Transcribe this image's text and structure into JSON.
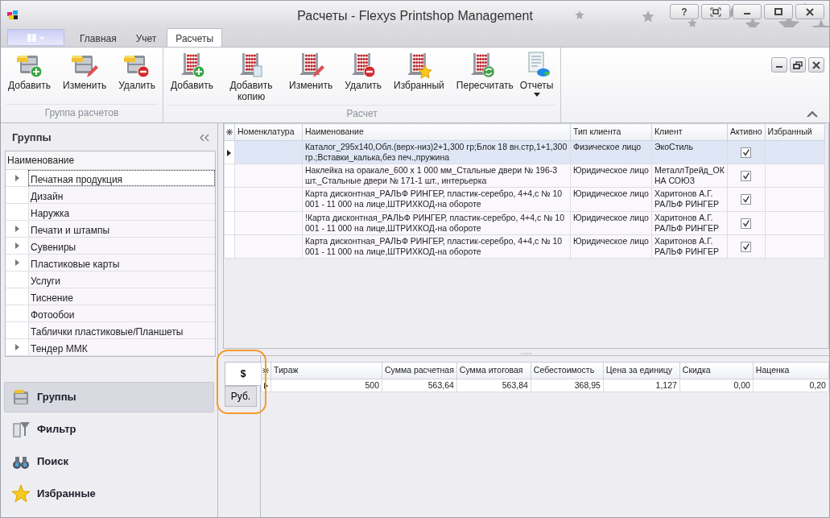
{
  "window": {
    "title": "Расчеты - Flexys Printshop Management",
    "controls": [
      {
        "kind": "help",
        "label": "?"
      },
      {
        "kind": "fullscreen"
      },
      {
        "kind": "minimize"
      },
      {
        "kind": "maximize"
      },
      {
        "kind": "close"
      }
    ],
    "mdi_controls": [
      {
        "kind": "minimize"
      },
      {
        "kind": "restore"
      },
      {
        "kind": "close"
      }
    ]
  },
  "ribbon": {
    "tabs": [
      {
        "label": "Главная",
        "selected": false
      },
      {
        "label": "Учет",
        "selected": false
      },
      {
        "label": "Расчеты",
        "selected": true
      }
    ],
    "groups": [
      {
        "title": "Группа расчетов",
        "kind": "cabinet",
        "buttons": [
          {
            "label": "Добавить",
            "kind": "add"
          },
          {
            "label": "Изменить",
            "kind": "edit"
          },
          {
            "label": "Удалить",
            "kind": "delete"
          }
        ]
      },
      {
        "title": "Расчет",
        "kind": "abacus",
        "buttons": [
          {
            "label": "Добавить",
            "kind": "add"
          },
          {
            "label": "Добавить копию",
            "kind": "copy"
          },
          {
            "label": "Изменить",
            "kind": "edit"
          },
          {
            "label": "Удалить",
            "kind": "delete"
          },
          {
            "label": "Избранный",
            "kind": "favorite"
          },
          {
            "label": "Пересчитать",
            "kind": "recalc"
          },
          {
            "label": "Отчеты",
            "kind": "report",
            "dropdown": true
          }
        ]
      }
    ]
  },
  "left_panel": {
    "title": "Группы",
    "tree": {
      "column": "Наименование",
      "items": [
        {
          "label": "Печатная продукция",
          "expandable": true,
          "selected": true
        },
        {
          "label": "Дизайн",
          "expandable": false,
          "selected": false
        },
        {
          "label": "Наружка",
          "expandable": false,
          "selected": false
        },
        {
          "label": "Печати и штампы",
          "expandable": true,
          "selected": false
        },
        {
          "label": "Сувениры",
          "expandable": true,
          "selected": false
        },
        {
          "label": "Пластиковые карты",
          "expandable": true,
          "selected": false
        },
        {
          "label": "Услуги",
          "expandable": false,
          "selected": false
        },
        {
          "label": "Тиснение",
          "expandable": false,
          "selected": false
        },
        {
          "label": "Фотообои",
          "expandable": false,
          "selected": false
        },
        {
          "label": "Таблички пластиковые/Планшеты",
          "expandable": false,
          "selected": false
        },
        {
          "label": "Тендер ММК",
          "expandable": true,
          "selected": false
        }
      ]
    },
    "nav": [
      {
        "label": "Группы",
        "kind": "groups",
        "selected": true
      },
      {
        "label": "Фильтр",
        "kind": "filter",
        "selected": false
      },
      {
        "label": "Поиск",
        "kind": "search",
        "selected": false
      },
      {
        "label": "Избранные",
        "kind": "favorites",
        "selected": false
      }
    ]
  },
  "calculations": {
    "columns": [
      "Номенклатура",
      "Наименование",
      "Тип клиента",
      "Клиент",
      "Активно",
      "Избранный"
    ],
    "rows": [
      {
        "name": "Каталог_295x140,Обл.(верх-низ)2+1,300 гр;Блок 18 вн.стр,1+1,300 гр.;Вставки_калька,без печ.,пружина",
        "client_type": "Физическое лицо",
        "client": "ЭкоСтиль",
        "active": true,
        "selected": true
      },
      {
        "name": "Наклейка на оракале_600 х 1 000 мм_Стальные двери № 196-3 шт._Стальные двери № 171-1 шт., интерьерка",
        "client_type": "Юридическое лицо",
        "client": "МеталлТрейд_ОКНА СОЮЗ",
        "active": true,
        "selected": false
      },
      {
        "name": "Карта дисконтная_РАЛЬФ РИНГЕР, пластик-серебро, 4+4,с № 10 001 - 11 000 на лице,ШТРИХКОД-на обороте",
        "client_type": "Юридическое лицо",
        "client": "Харитонов А.Г. РАЛЬФ РИНГЕР",
        "active": true,
        "selected": false
      },
      {
        "name": "!Карта дисконтная_РАЛЬФ РИНГЕР, пластик-серебро, 4+4,с № 10 001 - 11 000 на лице,ШТРИХКОД-на обороте",
        "client_type": "Юридическое лицо",
        "client": "Харитонов А.Г. РАЛЬФ РИНГЕР",
        "active": true,
        "selected": false
      },
      {
        "name": "Карта дисконтная_РАЛЬФ РИНГЕР, пластик-серебро, 4+4,с № 10 001 - 11 000 на лице,ШТРИХКОД-на обороте",
        "client_type": "Юридическое лицо",
        "client": "Харитонов А.Г. РАЛЬФ РИНГЕР",
        "active": true,
        "selected": false
      }
    ]
  },
  "details": {
    "currency_tabs": [
      {
        "label": "$",
        "selected": true
      },
      {
        "label": "Руб.",
        "selected": false
      }
    ],
    "columns": [
      "Тираж",
      "Сумма расчетная",
      "Сумма итоговая",
      "Себестоимость",
      "Цена за единицу",
      "Скидка",
      "Наценка"
    ],
    "rows": [
      {
        "values": [
          "500",
          "563,64",
          "563,84",
          "368,95",
          "1,127",
          "0,00",
          "0,20"
        ],
        "selected": true
      }
    ]
  }
}
